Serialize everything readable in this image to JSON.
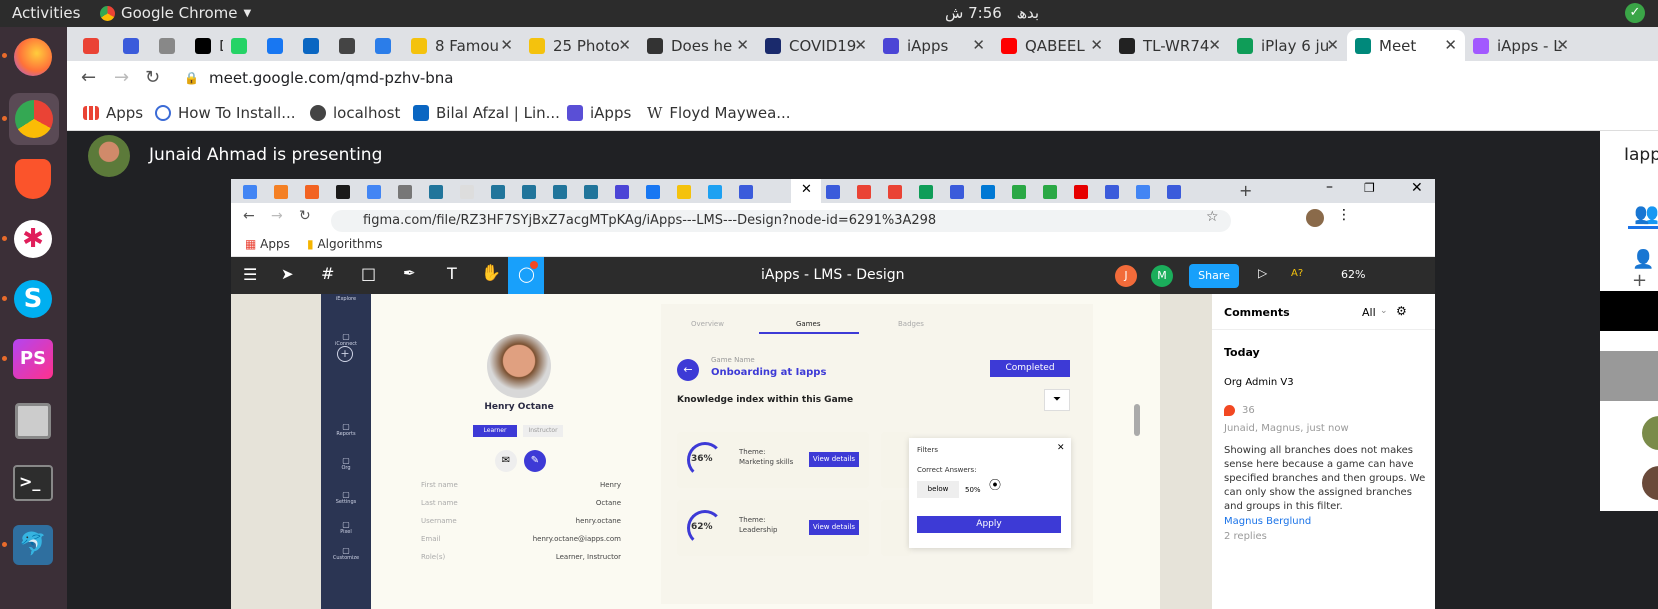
{
  "system": {
    "activities": "Activities",
    "app_name": "Google Chrome",
    "time": "7:56 ش",
    "day": "بدھ"
  },
  "chrome": {
    "tabs": [
      {
        "label": "",
        "color": "#ea4335"
      },
      {
        "label": "",
        "color": "#3b5bdb"
      },
      {
        "label": "",
        "color": "#888888"
      },
      {
        "label": "DEV",
        "color": "#000000"
      },
      {
        "label": "",
        "color": "#25d366"
      },
      {
        "label": "",
        "color": "#1877f2"
      },
      {
        "label": "",
        "color": "#0a66c2"
      },
      {
        "label": "",
        "color": "#444444"
      },
      {
        "label": "",
        "color": "#2b7de9"
      },
      {
        "label": "8 Famou",
        "color": "#f4c20d"
      },
      {
        "label": "25 Photo",
        "color": "#f4c20d"
      },
      {
        "label": "Does he",
        "color": "#333333"
      },
      {
        "label": "COVID19",
        "color": "#1a2a6c"
      },
      {
        "label": "iApps",
        "color": "#4b45d6"
      },
      {
        "label": "QABEEL",
        "color": "#ff0000"
      },
      {
        "label": "TL-WR74",
        "color": "#222222"
      },
      {
        "label": "iPlay 6 ju",
        "color": "#0f9d58"
      },
      {
        "label": "Meet",
        "color": "#00897b"
      },
      {
        "label": "iApps - L",
        "color": "#a259ff"
      }
    ],
    "url": "meet.google.com/qmd-pzhv-bna",
    "bookmarks": [
      {
        "label": "Apps",
        "icon": "apps-grid-icon"
      },
      {
        "label": "How To Install...",
        "icon": "circle-icon"
      },
      {
        "label": "localhost",
        "icon": "globe-icon"
      },
      {
        "label": "Bilal Afzal | Lin...",
        "icon": "linkedin-icon"
      },
      {
        "label": "iApps",
        "icon": "iapps-icon"
      },
      {
        "label": "Floyd Maywea...",
        "icon": "wikipedia-icon"
      }
    ]
  },
  "meet": {
    "presenting_text": "Junaid Ahmad is presenting",
    "side_label": "Iapps"
  },
  "shared": {
    "url": "figma.com/file/RZ3HF7SYjBxZ7acgMTpKAg/iApps---LMS---Design?node-id=6291%3A298",
    "bookmarks": [
      "Apps",
      "Algorithms"
    ],
    "figma": {
      "title": "iApps - LMS - Design",
      "share": "Share",
      "zoom": "62%",
      "avatars": [
        "J",
        "M"
      ]
    },
    "design": {
      "sidebar": [
        "iExplore",
        "iConnect",
        "Reports",
        "Org",
        "Settings",
        "Pixel",
        "Customize"
      ],
      "profile_name": "Henry Octane",
      "roles": [
        "Learner",
        "Instructor"
      ],
      "fields": [
        {
          "label": "First name",
          "value": "Henry"
        },
        {
          "label": "Last name",
          "value": "Octane"
        },
        {
          "label": "Username",
          "value": "henry.octane"
        },
        {
          "label": "Email",
          "value": "henry.octane@iapps.com"
        },
        {
          "label": "Role(s)",
          "value": "Learner, Instructor"
        }
      ],
      "tabs": [
        "Overview",
        "Games",
        "Badges"
      ],
      "game_label": "Game Name",
      "game_name": "Onboarding at Iapps",
      "completed": "Completed",
      "knowledge_title": "Knowledge index within this Game",
      "cards": [
        {
          "pct": "36%",
          "theme": "Theme:",
          "topic": "Marketing skills",
          "btn": "View details"
        },
        {
          "pct": "62%",
          "theme": "Theme:",
          "topic": "Leadership",
          "btn": "View details"
        }
      ],
      "filter": {
        "title": "Filters",
        "label": "Correct Answers:",
        "op": "below",
        "value": "50%",
        "apply": "Apply"
      }
    },
    "comments": {
      "header": "Comments",
      "filter": "All",
      "today": "Today",
      "section": "Org Admin V3",
      "count": "36",
      "authors": "Junaid, Magnus, just now",
      "body": "Showing all branches does not makes sense here because a game can have specified branches and then groups. We can only show the assigned branches and groups in this filter.",
      "mention": "Magnus Berglund",
      "replies": "2 replies"
    }
  }
}
